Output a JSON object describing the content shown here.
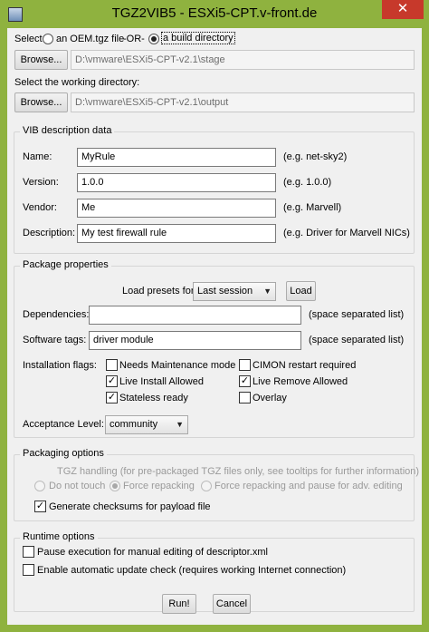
{
  "window": {
    "title": "TGZ2VIB5 - ESXi5-CPT.v-front.de",
    "close_glyph": "✕",
    "accent_color": "#8fb23f"
  },
  "source": {
    "select_label": "Select",
    "option_oem": "an OEM.tgz file",
    "or_label": "-OR-",
    "option_build": "a build directory",
    "browse_label": "Browse...",
    "path": "D:\\vmware\\ESXi5-CPT-v2.1\\stage"
  },
  "workdir": {
    "label": "Select the working directory:",
    "browse_label": "Browse...",
    "path": "D:\\vmware\\ESXi5-CPT-v2.1\\output"
  },
  "vib": {
    "group_title": "VIB description data",
    "fields": [
      {
        "label": "Name:",
        "value": "MyRule",
        "hint": "(e.g. net-sky2)"
      },
      {
        "label": "Version:",
        "value": "1.0.0",
        "hint": "(e.g. 1.0.0)"
      },
      {
        "label": "Vendor:",
        "value": "Me",
        "hint": "(e.g. Marvell)"
      },
      {
        "label": "Description:",
        "value": "My test firewall rule",
        "hint": "(e.g. Driver for Marvell NICs)"
      }
    ]
  },
  "package": {
    "group_title": "Package properties",
    "presets_label": "Load presets for:",
    "presets_value": "Last session",
    "load_label": "Load",
    "dependencies_label": "Dependencies:",
    "dependencies_value": "",
    "dependencies_hint": "(space separated list)",
    "tags_label": "Software tags:",
    "tags_value": "driver module",
    "tags_hint": "(space separated list)",
    "flags_label": "Installation flags:",
    "flags": [
      {
        "label": "Needs Maintenance mode",
        "checked": false
      },
      {
        "label": "CIMON restart required",
        "checked": false
      },
      {
        "label": "Live Install Allowed",
        "checked": true
      },
      {
        "label": "Live Remove Allowed",
        "checked": true
      },
      {
        "label": "Stateless ready",
        "checked": true
      },
      {
        "label": "Overlay",
        "checked": false
      }
    ],
    "acceptance_label": "Acceptance Level:",
    "acceptance_value": "community"
  },
  "packaging": {
    "group_title": "Packaging options",
    "tgz_label": "TGZ handling (for pre-packaged TGZ files only, see tooltips for further information)",
    "options": [
      "Do not touch",
      "Force repacking",
      "Force repacking and pause for adv. editing"
    ],
    "checksums_label": "Generate checksums for payload file",
    "checksums_checked": true
  },
  "runtime": {
    "group_title": "Runtime options",
    "pause_label": "Pause execution for manual editing of descriptor.xml",
    "update_label": "Enable automatic update check (requires working Internet connection)"
  },
  "actions": {
    "run_label": "Run!",
    "cancel_label": "Cancel"
  }
}
